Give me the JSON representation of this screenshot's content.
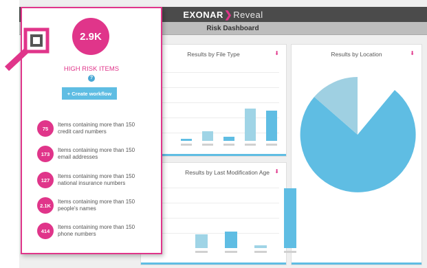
{
  "brand": {
    "ex": "EX",
    "on": "ON",
    "ar": "AR",
    "reveal": "Reveal",
    "accent": "#e0358a",
    "bar_color": "#5fbde3"
  },
  "page_title": "Risk Dashboard",
  "cards": {
    "file_type": {
      "title": "Results by File Type",
      "download_icon": "download-icon"
    },
    "location": {
      "title": "Results by Location",
      "download_icon": "download-icon"
    },
    "mod_age": {
      "title": "Results by Last Modification Age",
      "download_icon": "download-icon"
    }
  },
  "popup": {
    "total": "2.9K",
    "label": "HIGH RISK ITEMS",
    "help": "?",
    "workflow_button": "+ Create workflow",
    "items": [
      {
        "count": "75",
        "line1": "Items containing more than 150",
        "line2": "credit card numbers"
      },
      {
        "count": "173",
        "line1": "Items containing more than 150",
        "line2": "email addresses"
      },
      {
        "count": "127",
        "line1": "Items containing more than 150",
        "line2": "national insurance numbers"
      },
      {
        "count": "2.1K",
        "line1": "Items containing more than 150",
        "line2": "people's names"
      },
      {
        "count": "414",
        "line1": "Items containing more than 150",
        "line2": "phone numbers"
      }
    ]
  }
}
